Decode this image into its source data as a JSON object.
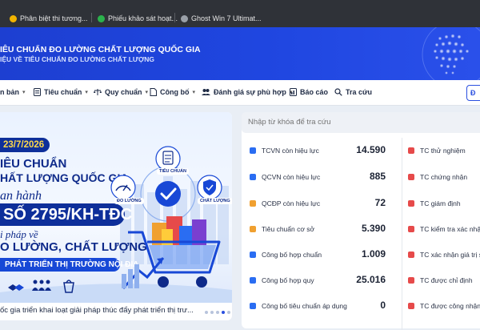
{
  "browser": {
    "top_fragment": "n",
    "bookmarks": [
      {
        "label": "Phân biệt thi tương...",
        "icon": "yellow-circle-icon",
        "color": "#f2b400"
      },
      {
        "label": "Phiếu khảo sát hoạt...",
        "icon": "green-circle-icon",
        "color": "#2bb24c"
      },
      {
        "label": "Ghost Win 7 Ultimat...",
        "icon": "globe-icon",
        "color": "#9aa0a8"
      }
    ]
  },
  "banner": {
    "title": "IÊU CHUẨN ĐO LƯỜNG CHẤT LƯỢNG QUỐC GIA",
    "subtitle": "IỆU VỀ TIÊU CHUẨN ĐO LƯỜNG CHẤT LƯỢNG"
  },
  "nav": {
    "items": [
      {
        "label": "n bản",
        "has_chevron": true,
        "icon": ""
      },
      {
        "label": "Tiêu chuẩn",
        "has_chevron": true,
        "icon": "document-icon"
      },
      {
        "label": "Quy chuẩn",
        "has_chevron": true,
        "icon": "scale-icon"
      },
      {
        "label": "Công bố",
        "has_chevron": true,
        "icon": "file-icon"
      },
      {
        "label": "Đánh giá sự phù hợp",
        "has_chevron": true,
        "icon": "people-icon"
      },
      {
        "label": "Báo cáo",
        "has_chevron": false,
        "icon": "report-icon"
      },
      {
        "label": "Tra cứu",
        "has_chevron": false,
        "icon": "search-icon"
      }
    ],
    "right_button": "Đ"
  },
  "promo": {
    "date": "23/7/2026",
    "line1": "IÊU CHUẨN",
    "line2": "HẤT LƯỢNG QUỐC GIA",
    "line3": "an hành",
    "line4": "SỐ 2795/KH-TĐC",
    "line5": "i pháp về",
    "line6": "O LƯỜNG, CHẤT LƯỢNG",
    "line7": "PHÁT TRIỂN THỊ TRƯỜNG NỘI ĐỊA",
    "label_standard": "TIÊU CHUẨN",
    "label_measure": "ĐO LƯỜNG",
    "label_quality": "CHẤT LƯỢNG",
    "caption": "ốc gia triển khai loạt giải pháp thúc đẩy phát triển thị trư..."
  },
  "search": {
    "placeholder": "Nhập từ khóa để tra cứu"
  },
  "stats_left": [
    {
      "label": "TCVN còn hiệu lực",
      "value": "14.590",
      "color": "#2a6df2"
    },
    {
      "label": "QCVN còn hiệu lực",
      "value": "885",
      "color": "#2a6df2"
    },
    {
      "label": "QCĐP còn hiệu lực",
      "value": "72",
      "color": "#f0a030"
    },
    {
      "label": "Tiêu chuẩn cơ sở",
      "value": "5.390",
      "color": "#f0a030"
    },
    {
      "label": "Công bố hợp chuẩn",
      "value": "1.009",
      "color": "#2a6df2"
    },
    {
      "label": "Công bố hợp quy",
      "value": "25.016",
      "color": "#2a6df2"
    },
    {
      "label": "Công bố tiêu chuẩn áp dụng",
      "value": "0",
      "color": "#2a6df2"
    }
  ],
  "stats_right": [
    {
      "label": "TC thử nghiệm",
      "color": "#e64a4a"
    },
    {
      "label": "TC chứng nhận",
      "color": "#e64a4a"
    },
    {
      "label": "TC giám định",
      "color": "#e64a4a"
    },
    {
      "label": "TC kiểm tra xác nhận",
      "color": "#e64a4a"
    },
    {
      "label": "TC xác nhận giá trị sử dụng",
      "color": "#e64a4a"
    },
    {
      "label": "TC được chỉ định",
      "color": "#e64a4a"
    },
    {
      "label": "TC được công nhận",
      "color": "#e64a4a"
    }
  ]
}
